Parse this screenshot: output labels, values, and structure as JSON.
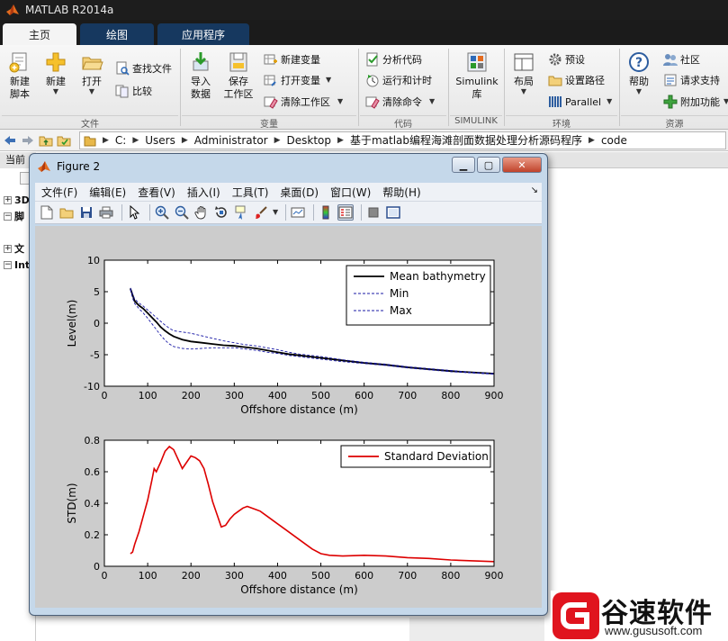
{
  "app": {
    "title": "MATLAB R2014a"
  },
  "ribbon_tabs": [
    {
      "label": "主页",
      "active": true
    },
    {
      "label": "绘图",
      "active": false
    },
    {
      "label": "应用程序",
      "active": false
    }
  ],
  "ribbon": {
    "file_group": {
      "label": "文件",
      "new_script": "新建\n脚本",
      "new": "新建",
      "open": "打开",
      "find_files": "查找文件",
      "compare": "比较"
    },
    "variable_group": {
      "label": "变量",
      "import_data": "导入\n数据",
      "save_workspace": "保存\n工作区",
      "new_variable": "新建变量",
      "open_variable": "打开变量",
      "clear_workspace": "清除工作区"
    },
    "code_group": {
      "label": "代码",
      "analyze_code": "分析代码",
      "run_and_time": "运行和计时",
      "clear_commands": "清除命令"
    },
    "simulink_group": {
      "label": "SIMULINK",
      "simulink_library": "Simulink\n库"
    },
    "environment_group": {
      "label": "环境",
      "layout": "布局",
      "preferences": "预设",
      "set_path": "设置路径",
      "parallel": "Parallel"
    },
    "resources_group": {
      "label": "资源",
      "help": "帮助",
      "community": "社区",
      "request_support": "请求支持",
      "add_ons": "附加功能"
    }
  },
  "address_bar": {
    "path": [
      "C:",
      "Users",
      "Administrator",
      "Desktop",
      "基于matlab编程海滩剖面数据处理分析源码程序",
      "code"
    ]
  },
  "left_panel": {
    "header": "当前",
    "items": [
      {
        "sign": "+",
        "text": "3D"
      },
      {
        "sign": "−",
        "text": "脚"
      },
      {
        "sign": "+",
        "text": "文"
      },
      {
        "sign": "−",
        "text": "Int"
      }
    ]
  },
  "figure": {
    "title": "Figure 2",
    "menu": [
      "文件(F)",
      "编辑(E)",
      "查看(V)",
      "插入(I)",
      "工具(T)",
      "桌面(D)",
      "窗口(W)",
      "帮助(H)"
    ],
    "toolbar_icons": [
      "new-figure-icon",
      "open-file-icon",
      "save-icon",
      "print-icon",
      "pointer-icon",
      "zoom-in-icon",
      "zoom-out-icon",
      "pan-icon",
      "rotate-icon",
      "data-cursor-icon",
      "brush-icon",
      "link-plot-icon",
      "colorbar-icon",
      "legend-icon",
      "hide-plot-tools-icon",
      "show-plot-tools-icon"
    ]
  },
  "chart_data": [
    {
      "type": "line",
      "xlabel": "Offshore distance (m)",
      "ylabel": "Level(m)",
      "xlim": [
        0,
        900
      ],
      "ylim": [
        -10,
        10
      ],
      "xticks": [
        0,
        100,
        200,
        300,
        400,
        500,
        600,
        700,
        800,
        900
      ],
      "yticks": [
        -10,
        -5,
        0,
        5,
        10
      ],
      "grid": false,
      "legend_position": "top-right",
      "series": [
        {
          "name": "Mean bathymetry",
          "color": "#000000",
          "style": "solid",
          "x": [
            60,
            65,
            70,
            80,
            90,
            100,
            110,
            120,
            130,
            140,
            150,
            160,
            180,
            200,
            225,
            250,
            275,
            300,
            325,
            350,
            375,
            400,
            425,
            450,
            475,
            500,
            550,
            600,
            650,
            700,
            750,
            800,
            850,
            900
          ],
          "y": [
            5.5,
            4.5,
            3.5,
            2.8,
            2.3,
            1.6,
            0.9,
            0.2,
            -0.6,
            -1.2,
            -1.7,
            -2.1,
            -2.6,
            -2.9,
            -3.1,
            -3.3,
            -3.5,
            -3.6,
            -3.8,
            -4.0,
            -4.3,
            -4.6,
            -4.9,
            -5.1,
            -5.3,
            -5.5,
            -5.9,
            -6.3,
            -6.6,
            -7.0,
            -7.3,
            -7.6,
            -7.8,
            -8.0
          ]
        },
        {
          "name": "Min",
          "color": "#1a1aa6",
          "style": "dashed",
          "x": [
            60,
            65,
            70,
            80,
            90,
            100,
            110,
            120,
            130,
            140,
            150,
            160,
            180,
            200,
            225,
            250,
            275,
            300,
            325,
            350,
            375,
            400,
            425,
            450,
            475,
            500,
            550,
            600,
            650,
            700,
            750,
            800,
            850,
            900
          ],
          "y": [
            5.3,
            4.0,
            3.1,
            2.3,
            1.6,
            0.8,
            -0.1,
            -1.0,
            -1.9,
            -2.7,
            -3.3,
            -3.7,
            -4.0,
            -4.1,
            -4.0,
            -3.9,
            -3.9,
            -3.9,
            -4.1,
            -4.3,
            -4.6,
            -4.8,
            -5.1,
            -5.3,
            -5.5,
            -5.7,
            -6.1,
            -6.4,
            -6.7,
            -7.1,
            -7.4,
            -7.7,
            -7.9,
            -8.1
          ]
        },
        {
          "name": "Max",
          "color": "#1a1aa6",
          "style": "dashed",
          "x": [
            60,
            65,
            70,
            80,
            90,
            100,
            110,
            120,
            130,
            140,
            150,
            160,
            180,
            200,
            225,
            250,
            275,
            300,
            325,
            350,
            375,
            400,
            425,
            450,
            475,
            500,
            550,
            600,
            650,
            700,
            750,
            800,
            850,
            900
          ],
          "y": [
            5.6,
            4.7,
            3.8,
            3.2,
            2.7,
            2.1,
            1.5,
            0.9,
            0.3,
            -0.3,
            -0.8,
            -1.2,
            -1.4,
            -1.6,
            -2.0,
            -2.4,
            -2.8,
            -3.1,
            -3.4,
            -3.6,
            -3.9,
            -4.2,
            -4.6,
            -4.9,
            -5.1,
            -5.3,
            -5.8,
            -6.2,
            -6.5,
            -6.9,
            -7.2,
            -7.5,
            -7.8,
            -8.0
          ]
        }
      ]
    },
    {
      "type": "line",
      "xlabel": "Offshore distance (m)",
      "ylabel": "STD(m)",
      "xlim": [
        0,
        900
      ],
      "ylim": [
        0,
        0.8
      ],
      "xticks": [
        0,
        100,
        200,
        300,
        400,
        500,
        600,
        700,
        800,
        900
      ],
      "yticks": [
        0,
        0.2,
        0.4,
        0.6,
        0.8
      ],
      "grid": false,
      "legend_position": "top-right",
      "series": [
        {
          "name": "Standard Deviation",
          "color": "#dd0000",
          "style": "solid",
          "x": [
            60,
            65,
            70,
            80,
            90,
            100,
            110,
            115,
            120,
            130,
            140,
            150,
            160,
            170,
            180,
            190,
            200,
            210,
            220,
            230,
            240,
            250,
            260,
            270,
            280,
            290,
            300,
            310,
            320,
            330,
            340,
            350,
            360,
            380,
            400,
            420,
            440,
            460,
            480,
            500,
            520,
            550,
            600,
            650,
            700,
            750,
            800,
            850,
            900
          ],
          "y": [
            0.08,
            0.09,
            0.14,
            0.22,
            0.32,
            0.42,
            0.55,
            0.62,
            0.6,
            0.66,
            0.73,
            0.76,
            0.74,
            0.68,
            0.62,
            0.66,
            0.7,
            0.69,
            0.67,
            0.62,
            0.52,
            0.41,
            0.33,
            0.25,
            0.26,
            0.3,
            0.33,
            0.35,
            0.37,
            0.38,
            0.37,
            0.36,
            0.35,
            0.31,
            0.27,
            0.23,
            0.19,
            0.15,
            0.11,
            0.08,
            0.07,
            0.065,
            0.07,
            0.065,
            0.055,
            0.05,
            0.04,
            0.035,
            0.03
          ]
        }
      ]
    }
  ],
  "watermark": {
    "name": "谷速软件",
    "url": "www.gususoft.com"
  }
}
